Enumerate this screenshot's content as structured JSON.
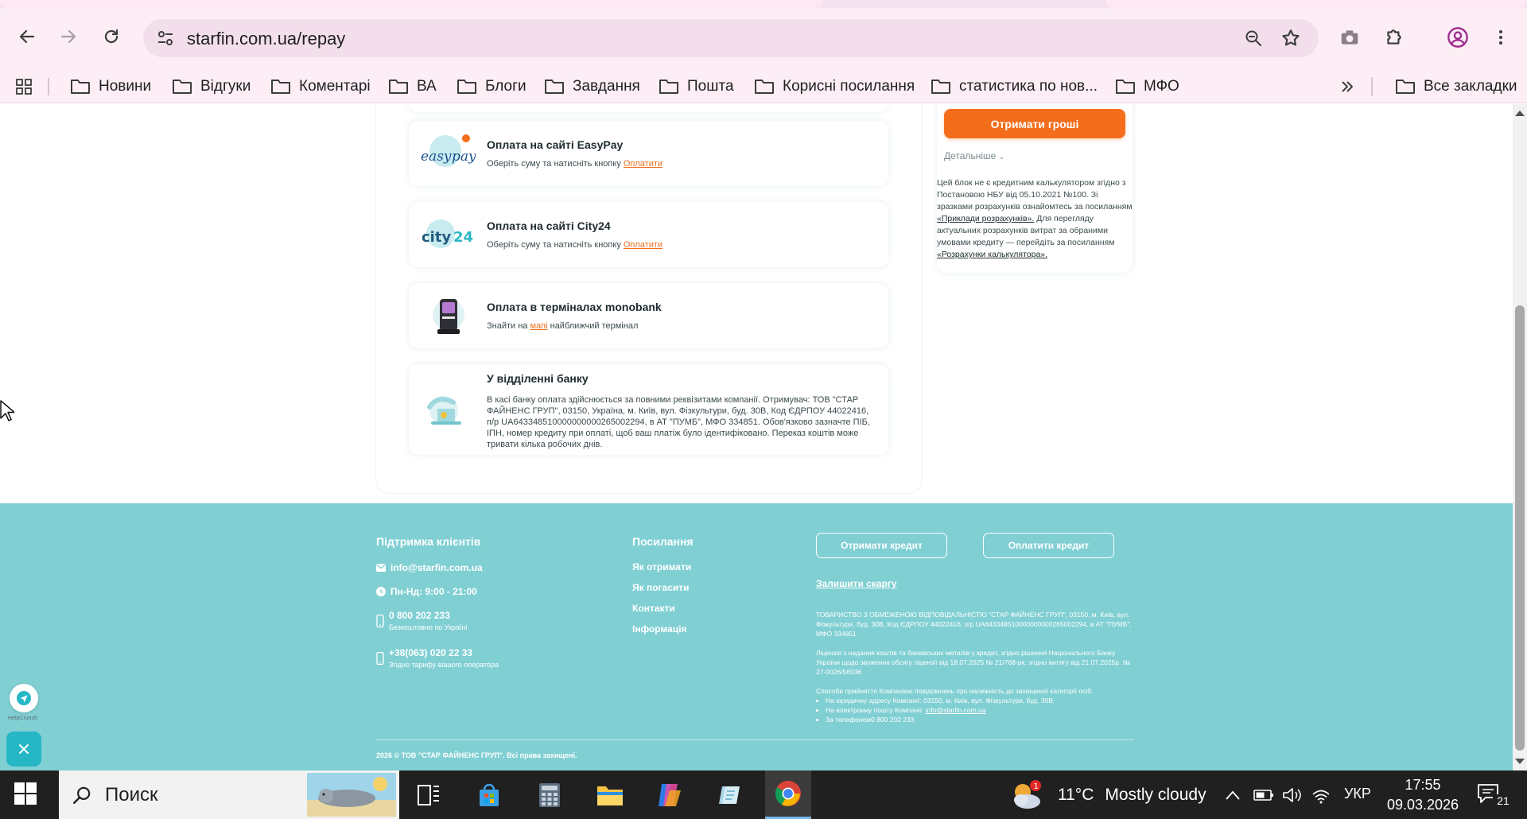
{
  "browser": {
    "url": "starfin.com.ua/repay",
    "bookmarks": [
      "Новини",
      "Відгуки",
      "Коментарі",
      "ВА",
      "Блоги",
      "Завдання",
      "Пошта",
      "Корисні посилання",
      "статистика по нов...",
      "МФО"
    ],
    "all_bookmarks": "Все закладки"
  },
  "payment_methods": [
    {
      "title": "Оплата на сайті EasyPay",
      "desc_pre": "Оберіть суму та натисніть кнопку ",
      "link": "Оплатити",
      "desc_post": "",
      "icon": "easypay-logo"
    },
    {
      "title": "Оплата на сайті City24",
      "desc_pre": "Оберіть суму та натисніть кнопку ",
      "link": "Оплатити",
      "desc_post": "",
      "icon": "city24-logo"
    },
    {
      "title": "Оплата в терміналах monobank",
      "desc_pre": "Знайти на ",
      "link": "мапі",
      "desc_post": " найближчий термінал",
      "icon": "terminal-icon"
    },
    {
      "title": "У відділенні банку",
      "desc_pre": "В касі банку оплата здійснюється за повними реквізитами компанії. Отримувач: ТОВ \"СТАР ФАЙНЕНС ГРУП\", 03150, Україна, м. Київ, вул. Фізкультури, буд. 30В, Код ЄДРПОУ 44022416, п/р UA643348510000000000265002294, в АТ \"ПУМБ\", МФО 334851. Обов'язково зазначте ПІБ, ІПН, номер кредиту при оплаті, щоб ваш платіж було ідентифіковано. Переказ коштів може тривати кілька робочих днів.",
      "link": "",
      "desc_post": "",
      "icon": "bank-branch-icon"
    }
  ],
  "sidebar": {
    "get_money_button": "Отримати гроші",
    "details_link": "Детальніше",
    "disclaimer_pre": "Цей блок не є кредитним калькулятором згідно з Постановою НБУ від 05.10.2021 №100. Зі зразками розрахунків ознайомтесь за посиланням ",
    "disclaimer_link1": "«Приклади розрахунків».",
    "disclaimer_mid": " Для перегляду актуальних розрахунків витрат за обраними умовами кредиту — перейдіть за посиланням ",
    "disclaimer_link2": "«Розрахунки калькулятора»."
  },
  "footer": {
    "support_heading": "Підтримка клієнтів",
    "email": "info@starfin.com.ua",
    "hours": "Пн-Нд: 9:00 - 21:00",
    "phone1": "0 800 202 233",
    "phone1_note": "Безкоштовно по Україні",
    "phone2": "+38(063) 020 22 33",
    "phone2_note": "Згідно тарифу вашого оператора",
    "links_heading": "Посилання",
    "links": [
      "Як отримати",
      "Як погасити",
      "Контакти",
      "Інформація"
    ],
    "btn_get_credit": "Отримати кредит",
    "btn_pay_credit": "Оплатити кредит",
    "complaint_link": "Залишити скаргу",
    "legal1": "ТОВАРИСТВО З ОБМЕЖЕНОЮ ВІДПОВІДАЛЬНІСТЮ \"СТАР ФАЙНЕНС ГРУП\", 03150, м. Київ, вул. Фізкультури, буд. 30В, Код ЄДРПОУ 44022416, п/р UA643348510000000000265002294, в АТ \"ПУМБ\", МФО 334851",
    "legal2": "Ліцензія з надання коштів та банківських металів у кредит, згідно рішення Національного Банку України щодо звуження обсягу ліцензії від 18.07.2025 № 21/768-рк, згідно витягу від 21.07.2025р. № 27-0026/56036",
    "legal3_head": "Способи прийняття Компанією повідомлень про належність до захищеної категорії осіб:",
    "legal3_items": [
      "На юридичну адресу Компанії: 03150, м. Київ, вул. Фізкультури, буд. 30В",
      "На електронну пошту Компанії: ",
      "За телефоном0 800 202 233"
    ],
    "legal3_email": "info@starfin.com.ua",
    "copyright": "2026 © ТОВ \"СТАР ФАЙНЕНС ГРУП\". Всі права захищені."
  },
  "widget": {
    "chat_label": "HelpCrunch"
  },
  "taskbar": {
    "search_placeholder": "Поиск",
    "weather_temp": "11°C",
    "weather_desc": "Mostly cloudy",
    "weather_badge": "1",
    "language": "УКР",
    "time": "17:55",
    "date": "09.03.2026",
    "notifications_count": "21"
  },
  "colors": {
    "accent_orange": "#f46d1b",
    "footer_teal": "#80cfd3",
    "chrome_pink": "#fdeef6"
  }
}
